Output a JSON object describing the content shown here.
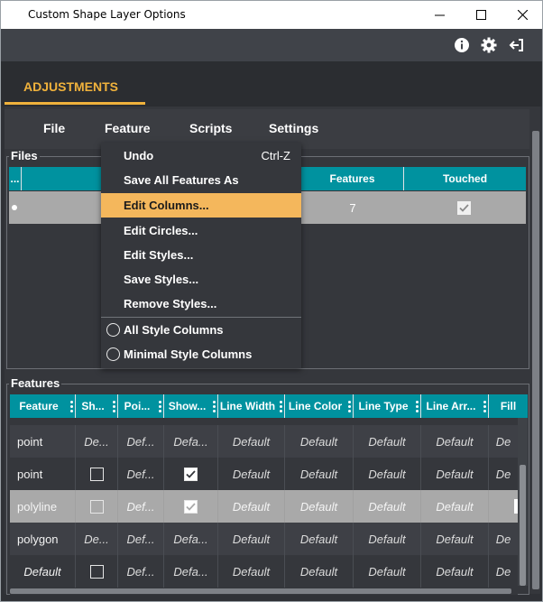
{
  "window": {
    "title": "Custom Shape Layer Options",
    "controls": [
      "minimize-icon",
      "maximize-icon",
      "close-icon"
    ]
  },
  "header": {
    "icons": [
      "info-icon",
      "gear-icon",
      "exit-icon"
    ]
  },
  "tabs": [
    {
      "label": "ADJUSTMENTS",
      "active": true
    }
  ],
  "menubar": {
    "items": [
      "File",
      "Feature",
      "Scripts",
      "Settings"
    ]
  },
  "files_panel": {
    "title": "Files",
    "columns": [
      "...",
      "Features",
      "Touched"
    ],
    "rows": [
      {
        "features": "7",
        "touched": true
      }
    ]
  },
  "dropdown": {
    "items": [
      {
        "label": "Undo",
        "shortcut": "Ctrl-Z"
      },
      {
        "label": "Save All Features As"
      },
      {
        "label": "Edit Columns...",
        "highlighted": true
      },
      {
        "label": "Edit Circles..."
      },
      {
        "label": "Edit Styles..."
      },
      {
        "label": "Save Styles..."
      },
      {
        "label": "Remove Styles..."
      },
      {
        "label": "All Style Columns",
        "radio": true
      },
      {
        "label": "Minimal Style Columns",
        "radio": true
      }
    ]
  },
  "features_panel": {
    "title": "Features",
    "columns": [
      "Feature",
      "Sh...",
      "Poi...",
      "Show...",
      "Line Width",
      "Line Color",
      "Line Type",
      "Line Arr...",
      "Fill"
    ],
    "rows": [
      {
        "feature": "point",
        "sh": "De...",
        "poi": "Def...",
        "show": "Defa...",
        "lw": "Default",
        "lc": "Default",
        "lt": "Default",
        "la": "Default",
        "fill": "De"
      },
      {
        "feature": "point",
        "sh_checkbox": false,
        "poi": "Def...",
        "show_checkbox": true,
        "lw": "Default",
        "lc": "Default",
        "lt": "Default",
        "la": "Default",
        "fill": "De"
      },
      {
        "feature": "polyline",
        "sh_checkbox": false,
        "poi": "Def...",
        "show_checkbox": true,
        "lw": "Default",
        "lc": "Default",
        "lt": "Default",
        "la": "Default",
        "selected": true
      },
      {
        "feature": "polygon",
        "sh": "De...",
        "poi": "Def...",
        "show": "Defa...",
        "lw": "Default",
        "lc": "Default",
        "lt": "Default",
        "la": "Default",
        "fill": "De"
      },
      {
        "feature": "Default",
        "sh_checkbox": false,
        "poi": "Def...",
        "show": "Defa...",
        "lw": "Default",
        "lc": "Default",
        "lt": "Default",
        "la": "Default",
        "fill": "De"
      }
    ]
  },
  "colors": {
    "accent": "#f0b23c",
    "header_teal": "#00929f",
    "menu_highlight": "#f4b75c",
    "background": "#2f3136"
  }
}
